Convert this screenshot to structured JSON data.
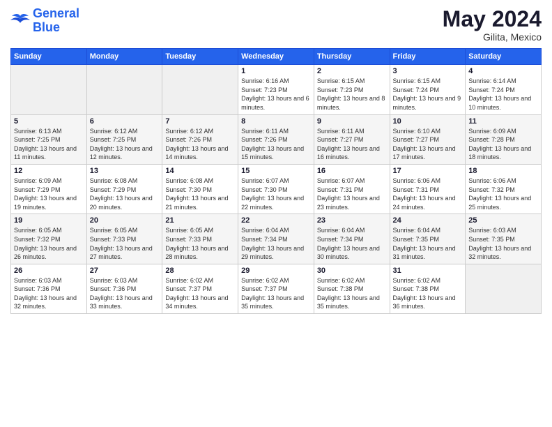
{
  "logo": {
    "line1": "General",
    "line2": "Blue"
  },
  "title": {
    "month_year": "May 2024",
    "location": "Gilita, Mexico"
  },
  "days_of_week": [
    "Sunday",
    "Monday",
    "Tuesday",
    "Wednesday",
    "Thursday",
    "Friday",
    "Saturday"
  ],
  "weeks": [
    [
      {
        "day": "",
        "info": ""
      },
      {
        "day": "",
        "info": ""
      },
      {
        "day": "",
        "info": ""
      },
      {
        "day": "1",
        "info": "Sunrise: 6:16 AM\nSunset: 7:23 PM\nDaylight: 13 hours and 6 minutes."
      },
      {
        "day": "2",
        "info": "Sunrise: 6:15 AM\nSunset: 7:23 PM\nDaylight: 13 hours and 8 minutes."
      },
      {
        "day": "3",
        "info": "Sunrise: 6:15 AM\nSunset: 7:24 PM\nDaylight: 13 hours and 9 minutes."
      },
      {
        "day": "4",
        "info": "Sunrise: 6:14 AM\nSunset: 7:24 PM\nDaylight: 13 hours and 10 minutes."
      }
    ],
    [
      {
        "day": "5",
        "info": "Sunrise: 6:13 AM\nSunset: 7:25 PM\nDaylight: 13 hours and 11 minutes."
      },
      {
        "day": "6",
        "info": "Sunrise: 6:12 AM\nSunset: 7:25 PM\nDaylight: 13 hours and 12 minutes."
      },
      {
        "day": "7",
        "info": "Sunrise: 6:12 AM\nSunset: 7:26 PM\nDaylight: 13 hours and 14 minutes."
      },
      {
        "day": "8",
        "info": "Sunrise: 6:11 AM\nSunset: 7:26 PM\nDaylight: 13 hours and 15 minutes."
      },
      {
        "day": "9",
        "info": "Sunrise: 6:11 AM\nSunset: 7:27 PM\nDaylight: 13 hours and 16 minutes."
      },
      {
        "day": "10",
        "info": "Sunrise: 6:10 AM\nSunset: 7:27 PM\nDaylight: 13 hours and 17 minutes."
      },
      {
        "day": "11",
        "info": "Sunrise: 6:09 AM\nSunset: 7:28 PM\nDaylight: 13 hours and 18 minutes."
      }
    ],
    [
      {
        "day": "12",
        "info": "Sunrise: 6:09 AM\nSunset: 7:29 PM\nDaylight: 13 hours and 19 minutes."
      },
      {
        "day": "13",
        "info": "Sunrise: 6:08 AM\nSunset: 7:29 PM\nDaylight: 13 hours and 20 minutes."
      },
      {
        "day": "14",
        "info": "Sunrise: 6:08 AM\nSunset: 7:30 PM\nDaylight: 13 hours and 21 minutes."
      },
      {
        "day": "15",
        "info": "Sunrise: 6:07 AM\nSunset: 7:30 PM\nDaylight: 13 hours and 22 minutes."
      },
      {
        "day": "16",
        "info": "Sunrise: 6:07 AM\nSunset: 7:31 PM\nDaylight: 13 hours and 23 minutes."
      },
      {
        "day": "17",
        "info": "Sunrise: 6:06 AM\nSunset: 7:31 PM\nDaylight: 13 hours and 24 minutes."
      },
      {
        "day": "18",
        "info": "Sunrise: 6:06 AM\nSunset: 7:32 PM\nDaylight: 13 hours and 25 minutes."
      }
    ],
    [
      {
        "day": "19",
        "info": "Sunrise: 6:05 AM\nSunset: 7:32 PM\nDaylight: 13 hours and 26 minutes."
      },
      {
        "day": "20",
        "info": "Sunrise: 6:05 AM\nSunset: 7:33 PM\nDaylight: 13 hours and 27 minutes."
      },
      {
        "day": "21",
        "info": "Sunrise: 6:05 AM\nSunset: 7:33 PM\nDaylight: 13 hours and 28 minutes."
      },
      {
        "day": "22",
        "info": "Sunrise: 6:04 AM\nSunset: 7:34 PM\nDaylight: 13 hours and 29 minutes."
      },
      {
        "day": "23",
        "info": "Sunrise: 6:04 AM\nSunset: 7:34 PM\nDaylight: 13 hours and 30 minutes."
      },
      {
        "day": "24",
        "info": "Sunrise: 6:04 AM\nSunset: 7:35 PM\nDaylight: 13 hours and 31 minutes."
      },
      {
        "day": "25",
        "info": "Sunrise: 6:03 AM\nSunset: 7:35 PM\nDaylight: 13 hours and 32 minutes."
      }
    ],
    [
      {
        "day": "26",
        "info": "Sunrise: 6:03 AM\nSunset: 7:36 PM\nDaylight: 13 hours and 32 minutes."
      },
      {
        "day": "27",
        "info": "Sunrise: 6:03 AM\nSunset: 7:36 PM\nDaylight: 13 hours and 33 minutes."
      },
      {
        "day": "28",
        "info": "Sunrise: 6:02 AM\nSunset: 7:37 PM\nDaylight: 13 hours and 34 minutes."
      },
      {
        "day": "29",
        "info": "Sunrise: 6:02 AM\nSunset: 7:37 PM\nDaylight: 13 hours and 35 minutes."
      },
      {
        "day": "30",
        "info": "Sunrise: 6:02 AM\nSunset: 7:38 PM\nDaylight: 13 hours and 35 minutes."
      },
      {
        "day": "31",
        "info": "Sunrise: 6:02 AM\nSunset: 7:38 PM\nDaylight: 13 hours and 36 minutes."
      },
      {
        "day": "",
        "info": ""
      }
    ]
  ]
}
